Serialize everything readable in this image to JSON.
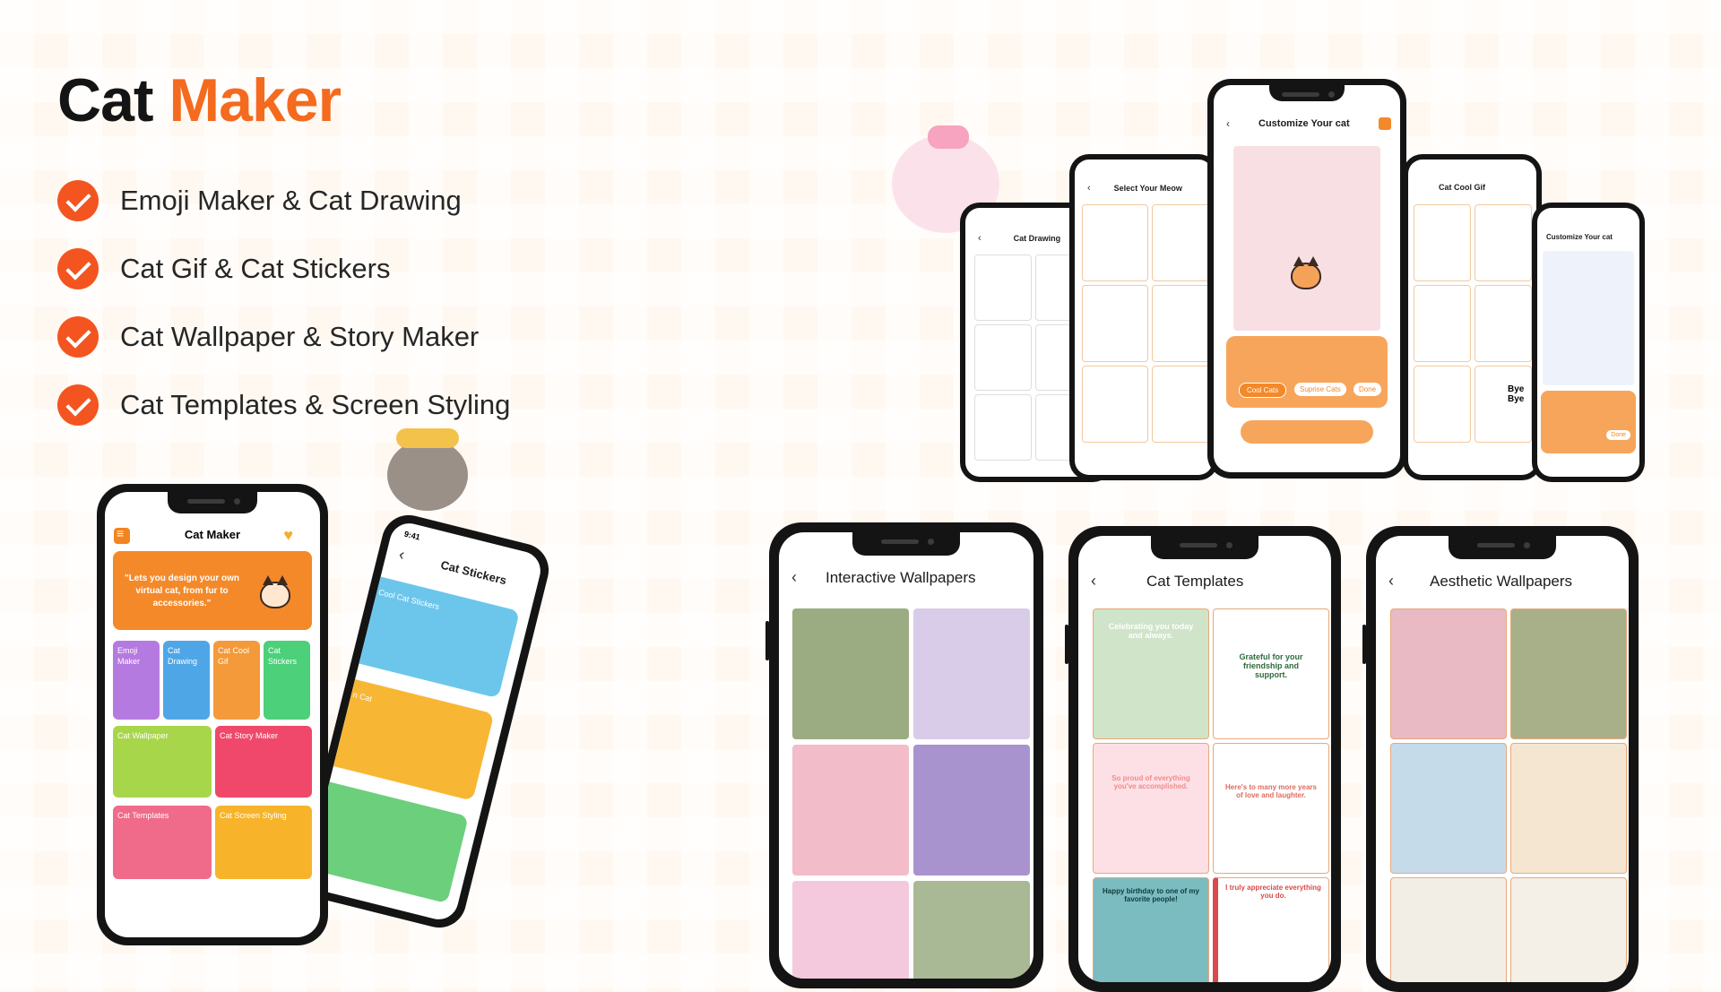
{
  "headline": {
    "word1": "Cat",
    "word2": "Maker"
  },
  "features": [
    {
      "label": "Emoji Maker & Cat Drawing"
    },
    {
      "label": "Cat Gif & Cat Stickers"
    },
    {
      "label": "Cat Wallpaper & Story Maker"
    },
    {
      "label": "Cat Templates & Screen Styling"
    }
  ],
  "colors": {
    "accent": "#f46a1f",
    "check": "#f4541f",
    "dark": "#141414"
  },
  "home_phone": {
    "title": "Cat Maker",
    "banner_quote": "\"Lets you design your own virtual cat, from fur to accessories.\"",
    "cards": [
      {
        "label": "Emoji Maker",
        "color": "#b57ae0"
      },
      {
        "label": "Cat Drawing",
        "color": "#4fa6e6"
      },
      {
        "label": "Cat Cool Gif",
        "color": "#f49a3a"
      },
      {
        "label": "Cat Stickers",
        "color": "#4cd07a"
      },
      {
        "label": "Cat Wallpaper",
        "color": "#a8d64a"
      },
      {
        "label": "Cat Story Maker",
        "color": "#f0486a"
      },
      {
        "label": "Cat Templates",
        "color": "#f06a8a"
      },
      {
        "label": "Cat Screen Styling",
        "color": "#f7b42a"
      }
    ]
  },
  "stickers_phone": {
    "title": "Cat Stickers",
    "time": "9:41",
    "strips": [
      "Cool Cat Stickers",
      "n Cat",
      ""
    ]
  },
  "top_row": {
    "drawing_title": "Cat Drawing",
    "meow_title": "Select Your Meow",
    "customize_title": "Customize Your cat",
    "customize_buttons": [
      "Cool Cats",
      "Suprise Cats",
      "Done"
    ],
    "gif_title": "Cat Cool Gif",
    "customize2_title": "Customize Your cat",
    "bye_text": "Bye Bye",
    "done2": "Done"
  },
  "wallpapers_phone": {
    "title": "Interactive Wallpapers"
  },
  "templates_phone": {
    "title": "Cat Templates",
    "messages": [
      "Celebrating you today and always.",
      "Grateful for your friendship and support.",
      "So proud of everything you've accomplished.",
      "Here's to many more years of love and laughter.",
      "Happy birthday to one of my favorite people!",
      "I truly appreciate everything you do."
    ]
  },
  "aesthetic_phone": {
    "title": "Aesthetic Wallpapers"
  }
}
